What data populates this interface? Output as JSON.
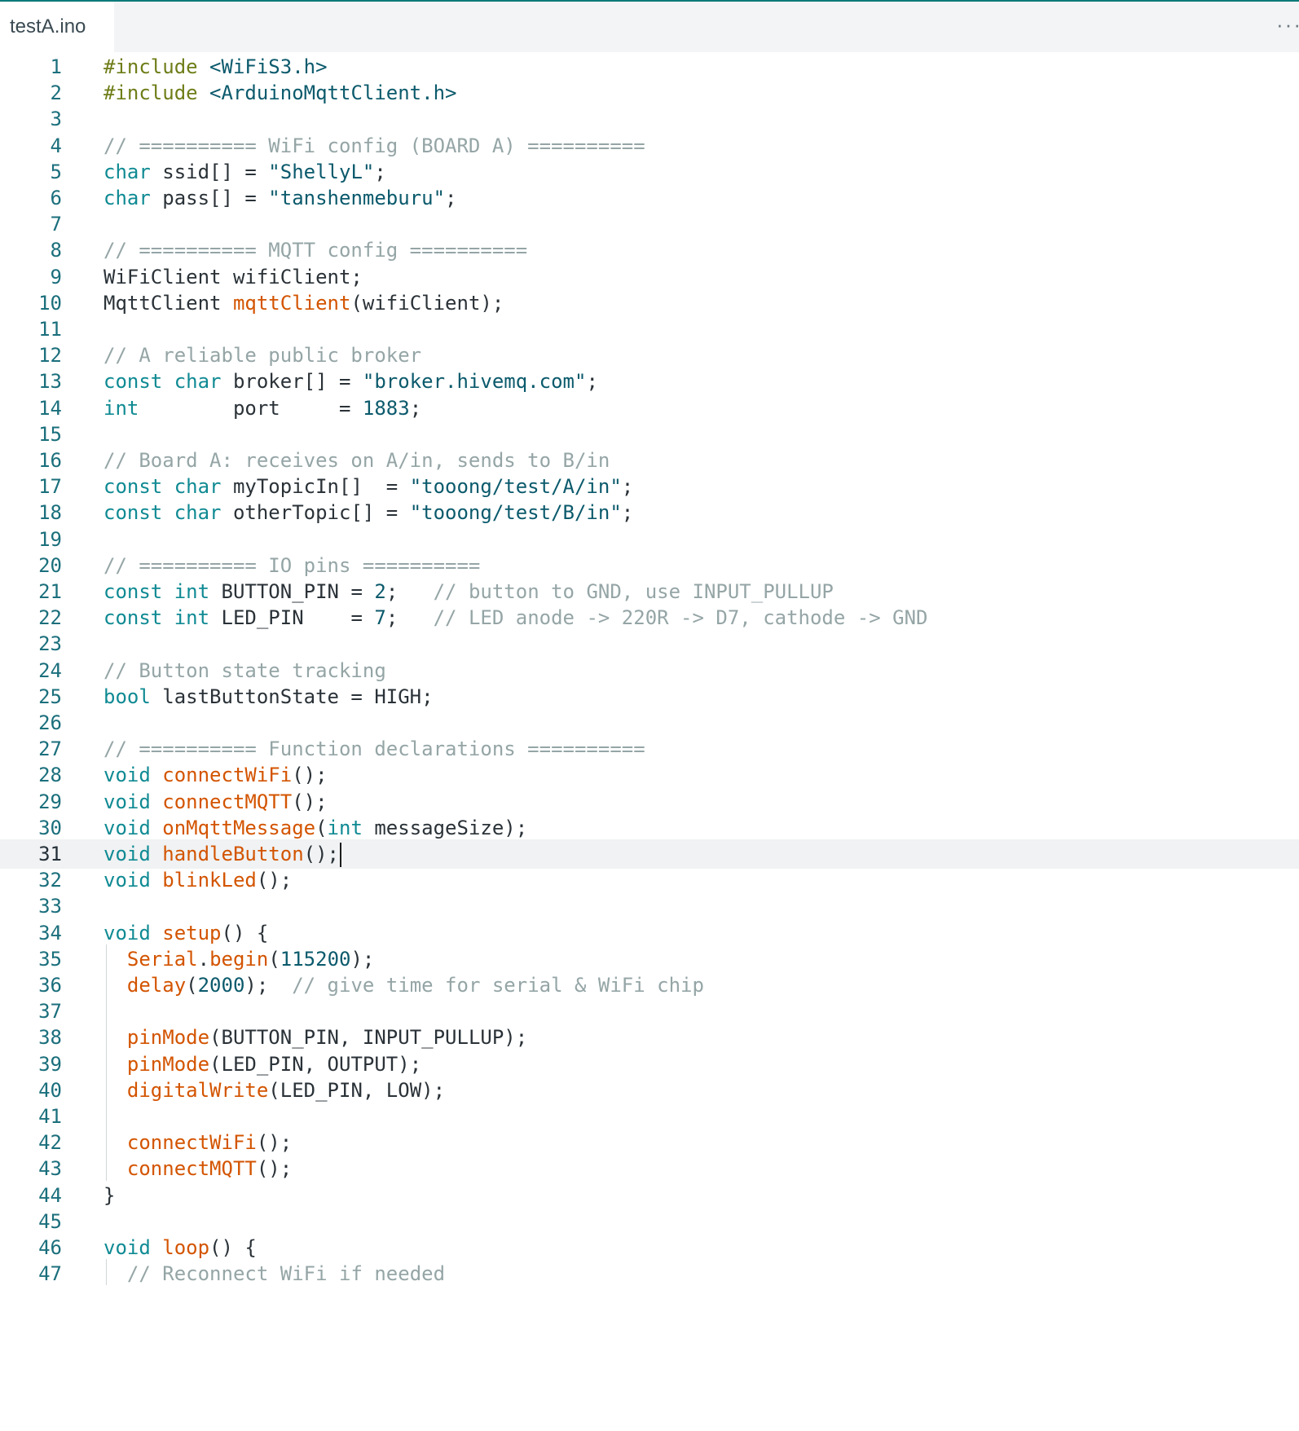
{
  "tab": {
    "filename": "testA.ino"
  },
  "more_icon": "ellipsis-icon",
  "colors": {
    "keyword": "#0f8a93",
    "preprocessor": "#6f7d18",
    "function": "#d35400",
    "string": "#0b5a6c",
    "comment": "#95a5a6",
    "accent": "#0b7a7a"
  },
  "editor": {
    "current_line": 31,
    "lines": [
      {
        "n": "1",
        "tokens": [
          [
            "pp",
            "#include"
          ],
          [
            "tx",
            " "
          ],
          [
            "str",
            "<WiFiS3.h>"
          ]
        ]
      },
      {
        "n": "2",
        "tokens": [
          [
            "pp",
            "#include"
          ],
          [
            "tx",
            " "
          ],
          [
            "str",
            "<ArduinoMqttClient.h>"
          ]
        ]
      },
      {
        "n": "3",
        "tokens": []
      },
      {
        "n": "4",
        "tokens": [
          [
            "cm",
            "// ========== WiFi config (BOARD A) =========="
          ]
        ]
      },
      {
        "n": "5",
        "tokens": [
          [
            "kw",
            "char"
          ],
          [
            "tx",
            " ssid[] = "
          ],
          [
            "str",
            "\"ShellyL\""
          ],
          [
            "tx",
            ";"
          ]
        ]
      },
      {
        "n": "6",
        "tokens": [
          [
            "kw",
            "char"
          ],
          [
            "tx",
            " pass[] = "
          ],
          [
            "str",
            "\"tanshenmeburu\""
          ],
          [
            "tx",
            ";"
          ]
        ]
      },
      {
        "n": "7",
        "tokens": []
      },
      {
        "n": "8",
        "tokens": [
          [
            "cm",
            "// ========== MQTT config =========="
          ]
        ]
      },
      {
        "n": "9",
        "tokens": [
          [
            "tx",
            "WiFiClient wifiClient;"
          ]
        ]
      },
      {
        "n": "10",
        "tokens": [
          [
            "tx",
            "MqttClient "
          ],
          [
            "fn",
            "mqttClient"
          ],
          [
            "tx",
            "(wifiClient);"
          ]
        ]
      },
      {
        "n": "11",
        "tokens": []
      },
      {
        "n": "12",
        "tokens": [
          [
            "cm",
            "// A reliable public broker"
          ]
        ]
      },
      {
        "n": "13",
        "tokens": [
          [
            "kw",
            "const"
          ],
          [
            "tx",
            " "
          ],
          [
            "kw",
            "char"
          ],
          [
            "tx",
            " broker[] = "
          ],
          [
            "str",
            "\"broker.hivemq.com\""
          ],
          [
            "tx",
            ";"
          ]
        ]
      },
      {
        "n": "14",
        "tokens": [
          [
            "kw",
            "int"
          ],
          [
            "tx",
            "        port     = "
          ],
          [
            "str",
            "1883"
          ],
          [
            "tx",
            ";"
          ]
        ]
      },
      {
        "n": "15",
        "tokens": []
      },
      {
        "n": "16",
        "tokens": [
          [
            "cm",
            "// Board A: receives on A/in, sends to B/in"
          ]
        ]
      },
      {
        "n": "17",
        "tokens": [
          [
            "kw",
            "const"
          ],
          [
            "tx",
            " "
          ],
          [
            "kw",
            "char"
          ],
          [
            "tx",
            " myTopicIn[]  = "
          ],
          [
            "str",
            "\"tooong/test/A/in\""
          ],
          [
            "tx",
            ";"
          ]
        ]
      },
      {
        "n": "18",
        "tokens": [
          [
            "kw",
            "const"
          ],
          [
            "tx",
            " "
          ],
          [
            "kw",
            "char"
          ],
          [
            "tx",
            " otherTopic[] = "
          ],
          [
            "str",
            "\"tooong/test/B/in\""
          ],
          [
            "tx",
            ";"
          ]
        ]
      },
      {
        "n": "19",
        "tokens": []
      },
      {
        "n": "20",
        "tokens": [
          [
            "cm",
            "// ========== IO pins =========="
          ]
        ]
      },
      {
        "n": "21",
        "tokens": [
          [
            "kw",
            "const"
          ],
          [
            "tx",
            " "
          ],
          [
            "kw",
            "int"
          ],
          [
            "tx",
            " BUTTON_PIN = "
          ],
          [
            "str",
            "2"
          ],
          [
            "tx",
            ";   "
          ],
          [
            "cm",
            "// button to GND, use INPUT_PULLUP"
          ]
        ]
      },
      {
        "n": "22",
        "tokens": [
          [
            "kw",
            "const"
          ],
          [
            "tx",
            " "
          ],
          [
            "kw",
            "int"
          ],
          [
            "tx",
            " LED_PIN    = "
          ],
          [
            "str",
            "7"
          ],
          [
            "tx",
            ";   "
          ],
          [
            "cm",
            "// LED anode -> 220R -> D7, cathode -> GND"
          ]
        ]
      },
      {
        "n": "23",
        "tokens": []
      },
      {
        "n": "24",
        "tokens": [
          [
            "cm",
            "// Button state tracking"
          ]
        ]
      },
      {
        "n": "25",
        "tokens": [
          [
            "kw",
            "bool"
          ],
          [
            "tx",
            " lastButtonState = HIGH;"
          ]
        ]
      },
      {
        "n": "26",
        "tokens": []
      },
      {
        "n": "27",
        "tokens": [
          [
            "cm",
            "// ========== Function declarations =========="
          ]
        ]
      },
      {
        "n": "28",
        "tokens": [
          [
            "kw",
            "void"
          ],
          [
            "tx",
            " "
          ],
          [
            "fn",
            "connectWiFi"
          ],
          [
            "tx",
            "();"
          ]
        ]
      },
      {
        "n": "29",
        "tokens": [
          [
            "kw",
            "void"
          ],
          [
            "tx",
            " "
          ],
          [
            "fn",
            "connectMQTT"
          ],
          [
            "tx",
            "();"
          ]
        ]
      },
      {
        "n": "30",
        "tokens": [
          [
            "kw",
            "void"
          ],
          [
            "tx",
            " "
          ],
          [
            "fn",
            "onMqttMessage"
          ],
          [
            "tx",
            "("
          ],
          [
            "kw",
            "int"
          ],
          [
            "tx",
            " messageSize);"
          ]
        ]
      },
      {
        "n": "31",
        "tokens": [
          [
            "kw",
            "void"
          ],
          [
            "tx",
            " "
          ],
          [
            "fn",
            "handleButton"
          ],
          [
            "tx",
            "();"
          ]
        ]
      },
      {
        "n": "32",
        "tokens": [
          [
            "kw",
            "void"
          ],
          [
            "tx",
            " "
          ],
          [
            "fn",
            "blinkLed"
          ],
          [
            "tx",
            "();"
          ]
        ]
      },
      {
        "n": "33",
        "tokens": []
      },
      {
        "n": "34",
        "tokens": [
          [
            "kw",
            "void"
          ],
          [
            "tx",
            " "
          ],
          [
            "fn",
            "setup"
          ],
          [
            "tx",
            "() {"
          ]
        ]
      },
      {
        "n": "35",
        "tokens": [
          [
            "tx",
            "  "
          ],
          [
            "fn",
            "Serial"
          ],
          [
            "tx",
            "."
          ],
          [
            "fn",
            "begin"
          ],
          [
            "tx",
            "("
          ],
          [
            "str",
            "115200"
          ],
          [
            "tx",
            ");"
          ]
        ]
      },
      {
        "n": "36",
        "tokens": [
          [
            "tx",
            "  "
          ],
          [
            "fn",
            "delay"
          ],
          [
            "tx",
            "("
          ],
          [
            "str",
            "2000"
          ],
          [
            "tx",
            ");  "
          ],
          [
            "cm",
            "// give time for serial & WiFi chip"
          ]
        ]
      },
      {
        "n": "37",
        "tokens": []
      },
      {
        "n": "38",
        "tokens": [
          [
            "tx",
            "  "
          ],
          [
            "fn",
            "pinMode"
          ],
          [
            "tx",
            "(BUTTON_PIN, INPUT_PULLUP);"
          ]
        ]
      },
      {
        "n": "39",
        "tokens": [
          [
            "tx",
            "  "
          ],
          [
            "fn",
            "pinMode"
          ],
          [
            "tx",
            "(LED_PIN, OUTPUT);"
          ]
        ]
      },
      {
        "n": "40",
        "tokens": [
          [
            "tx",
            "  "
          ],
          [
            "fn",
            "digitalWrite"
          ],
          [
            "tx",
            "(LED_PIN, LOW);"
          ]
        ]
      },
      {
        "n": "41",
        "tokens": []
      },
      {
        "n": "42",
        "tokens": [
          [
            "tx",
            "  "
          ],
          [
            "fn",
            "connectWiFi"
          ],
          [
            "tx",
            "();"
          ]
        ]
      },
      {
        "n": "43",
        "tokens": [
          [
            "tx",
            "  "
          ],
          [
            "fn",
            "connectMQTT"
          ],
          [
            "tx",
            "();"
          ]
        ]
      },
      {
        "n": "44",
        "tokens": [
          [
            "tx",
            "}"
          ]
        ]
      },
      {
        "n": "45",
        "tokens": []
      },
      {
        "n": "46",
        "tokens": [
          [
            "kw",
            "void"
          ],
          [
            "tx",
            " "
          ],
          [
            "fn",
            "loop"
          ],
          [
            "tx",
            "() {"
          ]
        ]
      },
      {
        "n": "47",
        "tokens": [
          [
            "tx",
            "  "
          ],
          [
            "cm",
            "// Reconnect WiFi if needed"
          ]
        ]
      }
    ]
  }
}
